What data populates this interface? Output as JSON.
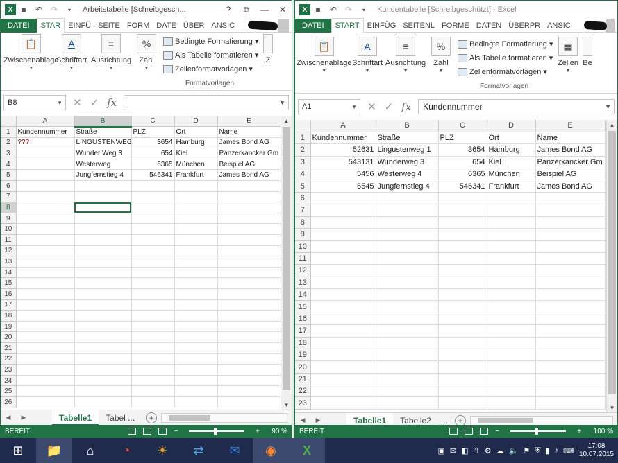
{
  "left_window": {
    "title": "Arbeitstabelle  [Schreibgesch...",
    "tabs": [
      "DATEI",
      "STAR",
      "EINFÜ",
      "SEITE",
      "FORM",
      "DATE",
      "ÜBER",
      "ANSIC"
    ],
    "ribbon": {
      "clipboard": "Zwischenablage",
      "font": "Schriftart",
      "alignment": "Ausrichtung",
      "number": "Zahl",
      "cond_format": "Bedingte Formatierung",
      "as_table": "Als Tabelle formatieren",
      "cell_styles": "Zellenformatvorlagen",
      "styles_group": "Formatvorlagen",
      "cut_label": "Z"
    },
    "namebox": "B8",
    "formula": "",
    "columns": [
      "A",
      "B",
      "C",
      "D",
      "E"
    ],
    "rows": [
      [
        "1",
        "Kundennummer",
        "Straße",
        "PLZ",
        "Ort",
        "Name"
      ],
      [
        "2",
        "???",
        "LINGUSTENWEG",
        "3654",
        "Hamburg",
        "James Bond AG"
      ],
      [
        "3",
        "",
        "Wunder Weg 3",
        "654",
        "Kiel",
        "Panzerkancker Gm"
      ],
      [
        "4",
        "",
        "Westerweg",
        "6365",
        "München",
        "Beispiel AG"
      ],
      [
        "5",
        "",
        "Jungfernstieg 4",
        "546341",
        "Frankfurt",
        "James Bond AG"
      ],
      [
        "6",
        "",
        "",
        "",
        "",
        ""
      ],
      [
        "7",
        "",
        "",
        "",
        "",
        ""
      ],
      [
        "8",
        "",
        "",
        "",
        "",
        ""
      ],
      [
        "9",
        "",
        "",
        "",
        "",
        ""
      ],
      [
        "10",
        "",
        "",
        "",
        "",
        ""
      ],
      [
        "11",
        "",
        "",
        "",
        "",
        ""
      ],
      [
        "12",
        "",
        "",
        "",
        "",
        ""
      ],
      [
        "13",
        "",
        "",
        "",
        "",
        ""
      ],
      [
        "14",
        "",
        "",
        "",
        "",
        ""
      ],
      [
        "15",
        "",
        "",
        "",
        "",
        ""
      ],
      [
        "16",
        "",
        "",
        "",
        "",
        ""
      ],
      [
        "17",
        "",
        "",
        "",
        "",
        ""
      ],
      [
        "18",
        "",
        "",
        "",
        "",
        ""
      ],
      [
        "19",
        "",
        "",
        "",
        "",
        ""
      ],
      [
        "20",
        "",
        "",
        "",
        "",
        ""
      ],
      [
        "21",
        "",
        "",
        "",
        "",
        ""
      ],
      [
        "22",
        "",
        "",
        "",
        "",
        ""
      ],
      [
        "23",
        "",
        "",
        "",
        "",
        ""
      ],
      [
        "24",
        "",
        "",
        "",
        "",
        ""
      ],
      [
        "25",
        "",
        "",
        "",
        "",
        ""
      ],
      [
        "26",
        "",
        "",
        "",
        "",
        ""
      ]
    ],
    "sheets": [
      "Tabelle1",
      "Tabel ..."
    ],
    "status": "BEREIT",
    "zoom": "90 %"
  },
  "right_window": {
    "title": "Kundentabelle  [Schreibgeschützt] - Excel",
    "tabs": [
      "DATEI",
      "START",
      "EINFÜG",
      "SEITENL",
      "FORME",
      "DATEN",
      "ÜBERPR",
      "ANSIC"
    ],
    "ribbon": {
      "clipboard": "Zwischenablage",
      "font": "Schriftart",
      "alignment": "Ausrichtung",
      "number": "Zahl",
      "cond_format": "Bedingte Formatierung",
      "as_table": "Als Tabelle formatieren",
      "cell_styles": "Zellenformatvorlagen",
      "styles_group": "Formatvorlagen",
      "cells": "Zellen",
      "editing": "Be"
    },
    "namebox": "A1",
    "formula": "Kundennummer",
    "columns": [
      "A",
      "B",
      "C",
      "D",
      "E"
    ],
    "rows": [
      [
        "1",
        "Kundennummer",
        "Straße",
        "PLZ",
        "Ort",
        "Name"
      ],
      [
        "2",
        "52631",
        "Lingustenweg 1",
        "3654",
        "Hamburg",
        "James Bond AG"
      ],
      [
        "3",
        "543131",
        "Wunderweg 3",
        "654",
        "Kiel",
        "Panzerkancker Gm"
      ],
      [
        "4",
        "5456",
        "Westerweg 4",
        "6365",
        "München",
        "Beispiel AG"
      ],
      [
        "5",
        "6545",
        "Jungfernstieg 4",
        "546341",
        "Frankfurt",
        "James Bond AG"
      ],
      [
        "6",
        "",
        "",
        "",
        "",
        ""
      ],
      [
        "7",
        "",
        "",
        "",
        "",
        ""
      ],
      [
        "8",
        "",
        "",
        "",
        "",
        ""
      ],
      [
        "9",
        "",
        "",
        "",
        "",
        ""
      ],
      [
        "10",
        "",
        "",
        "",
        "",
        ""
      ],
      [
        "11",
        "",
        "",
        "",
        "",
        ""
      ],
      [
        "12",
        "",
        "",
        "",
        "",
        ""
      ],
      [
        "13",
        "",
        "",
        "",
        "",
        ""
      ],
      [
        "14",
        "",
        "",
        "",
        "",
        ""
      ],
      [
        "15",
        "",
        "",
        "",
        "",
        ""
      ],
      [
        "16",
        "",
        "",
        "",
        "",
        ""
      ],
      [
        "17",
        "",
        "",
        "",
        "",
        ""
      ],
      [
        "18",
        "",
        "",
        "",
        "",
        ""
      ],
      [
        "19",
        "",
        "",
        "",
        "",
        ""
      ],
      [
        "20",
        "",
        "",
        "",
        "",
        ""
      ],
      [
        "21",
        "",
        "",
        "",
        "",
        ""
      ],
      [
        "22",
        "",
        "",
        "",
        "",
        ""
      ],
      [
        "23",
        "",
        "",
        "",
        "",
        ""
      ]
    ],
    "sheets": [
      "Tabelle1",
      "Tabelle2",
      "..."
    ],
    "status": "BEREIT",
    "zoom": "100 %"
  },
  "taskbar": {
    "time": "17:08",
    "date": "10.07.2015"
  },
  "colors": {
    "excel_green": "#217346",
    "error_red": "#c00000"
  }
}
